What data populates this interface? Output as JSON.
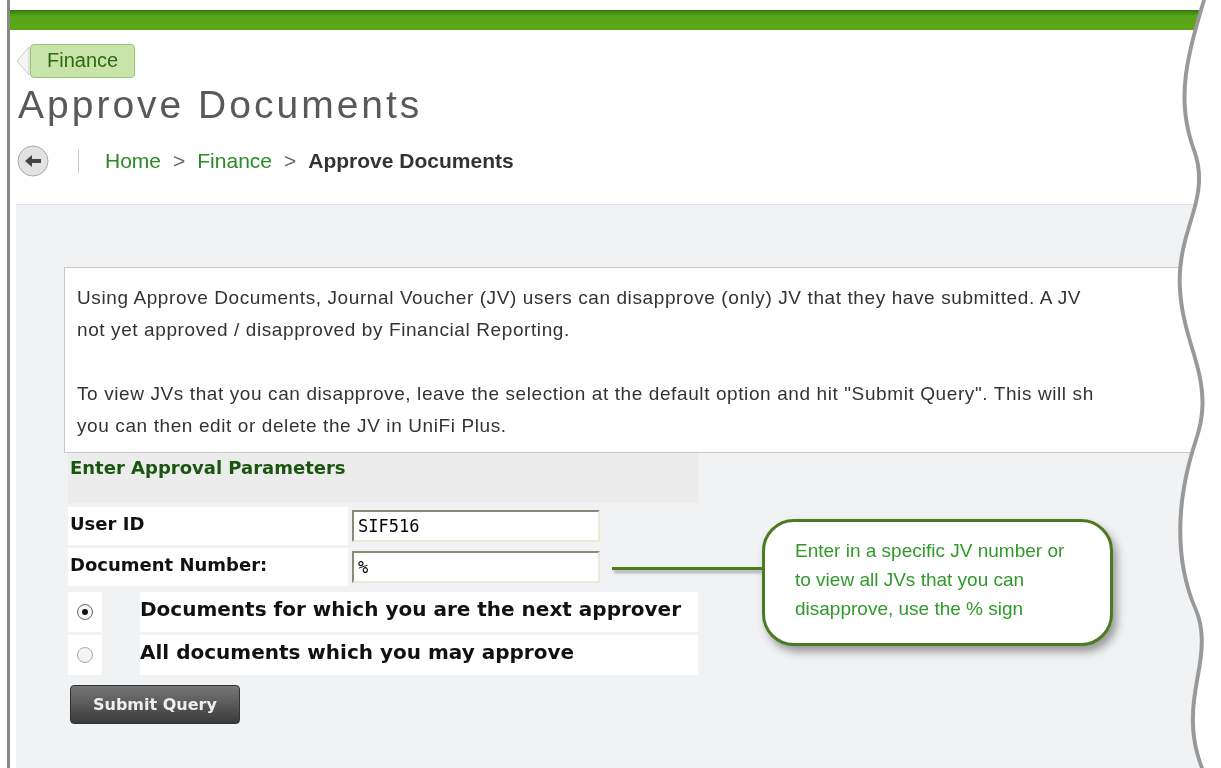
{
  "tag_button": {
    "label": "Finance"
  },
  "title": "Approve Documents",
  "breadcrumb": [
    {
      "label": "Home",
      "kind": "link"
    },
    {
      "label": ">",
      "kind": "separator"
    },
    {
      "label": "Finance",
      "kind": "link"
    },
    {
      "label": ">",
      "kind": "separator"
    },
    {
      "label": "Approve Documents",
      "kind": "current"
    }
  ],
  "intro": [
    [
      "Using Approve Documents, Journal Voucher (JV) users can disapprove (only) JV that they have submitted. A JV",
      "not yet approved / disapproved by Financial Reporting."
    ],
    [
      "To view JVs that you can disapprove, leave the selection at the default option and hit \"Submit Query\". This will sh",
      "you can then edit or delete the JV in UniFi Plus."
    ]
  ],
  "form": {
    "heading": "Enter Approval Parameters",
    "fields": [
      {
        "label": "User ID",
        "value": "SIF516"
      },
      {
        "label": "Document Number:",
        "value": "%"
      }
    ],
    "options": [
      {
        "label": "Documents for which you are the next approver",
        "selected": true
      },
      {
        "label": "All documents which you may approve",
        "selected": false
      }
    ],
    "submit": "Submit Query"
  },
  "callout": {
    "text": "Enter in a specific JV number or to view all JVs that you can disapprove, use the % sign"
  }
}
